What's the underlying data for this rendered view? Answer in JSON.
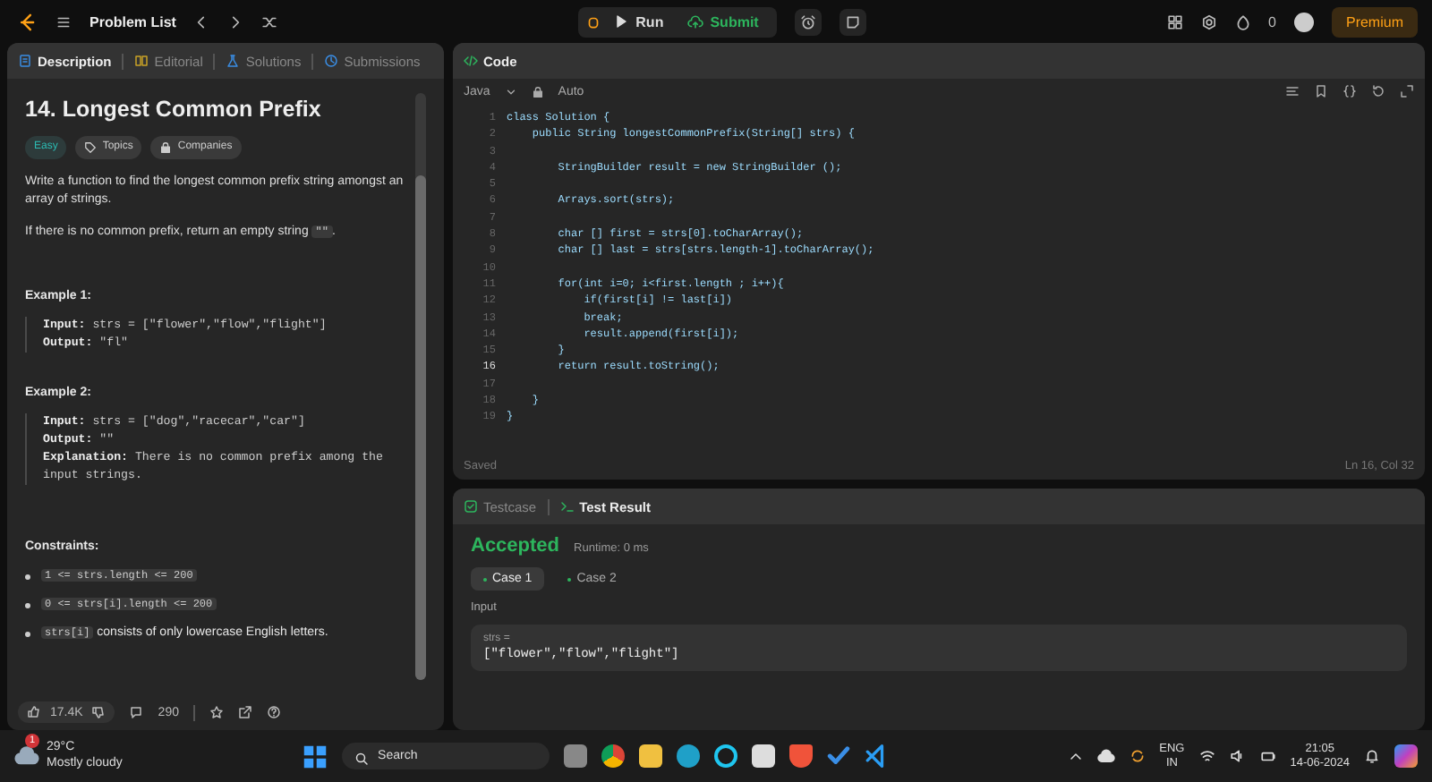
{
  "top_bar": {
    "nav_label": "Problem List",
    "run_label": "Run",
    "submit_label": "Submit",
    "streak_count": "0",
    "premium_label": "Premium"
  },
  "description_panel": {
    "tabs": [
      {
        "label": "Description",
        "selected": true
      },
      {
        "label": "Editorial",
        "selected": false
      },
      {
        "label": "Solutions",
        "selected": false
      },
      {
        "label": "Submissions",
        "selected": false
      }
    ],
    "title": "14. Longest Common Prefix",
    "difficulty": "Easy",
    "tags": [
      "Topics",
      "Companies"
    ],
    "paragraphs": [
      [
        {
          "kind": "text",
          "text": "Write a function to find the longest common prefix string amongst an array of strings."
        }
      ],
      [
        {
          "kind": "text",
          "text": "If there is no common prefix, return an empty string "
        },
        {
          "kind": "code",
          "text": "\"\""
        },
        {
          "kind": "text",
          "text": "."
        }
      ]
    ],
    "examples": [
      {
        "heading": "Example 1:",
        "lines": [
          {
            "label": "Input:",
            "value": "strs = [\"flower\",\"flow\",\"flight\"]"
          },
          {
            "label": "Output:",
            "value": "\"fl\""
          }
        ]
      },
      {
        "heading": "Example 2:",
        "lines": [
          {
            "label": "Input:",
            "value": "strs = [\"dog\",\"racecar\",\"car\"]"
          },
          {
            "label": "Output:",
            "value": "\"\""
          },
          {
            "label": "Explanation:",
            "value": "There is no common prefix among the input strings."
          }
        ]
      }
    ],
    "constraints_heading": "Constraints:",
    "constraints": [
      [
        {
          "kind": "code",
          "text": "1 <= strs.length <= 200"
        }
      ],
      [
        {
          "kind": "code",
          "text": "0 <= strs[i].length <= 200"
        }
      ],
      [
        {
          "kind": "code",
          "text": "strs[i]"
        },
        {
          "kind": "text",
          "text": " consists of only lowercase English letters."
        }
      ]
    ],
    "footer": {
      "likes": "17.4K",
      "comments": "290"
    }
  },
  "code_panel": {
    "title": "Code",
    "language": "Java",
    "mode": "Auto",
    "lines": [
      {
        "number": "1",
        "text": "class Solution {",
        "selected": false
      },
      {
        "number": "2",
        "text": "    public String longestCommonPrefix(String[] strs) {",
        "selected": false
      },
      {
        "number": "3",
        "selected": false
      },
      {
        "number": "4",
        "text": "        StringBuilder result = new StringBuilder ();",
        "selected": false
      },
      {
        "number": "5",
        "selected": false
      },
      {
        "number": "6",
        "text": "        Arrays.sort(strs);",
        "selected": false
      },
      {
        "number": "7",
        "selected": false
      },
      {
        "number": "8",
        "text": "        char [] first = strs[0].toCharArray();",
        "selected": false
      },
      {
        "number": "9",
        "text": "        char [] last = strs[strs.length-1].toCharArray();",
        "selected": false
      },
      {
        "number": "10",
        "selected": false
      },
      {
        "number": "11",
        "text": "        for(int i=0; i<first.length ; i++){",
        "selected": false
      },
      {
        "number": "12",
        "text": "            if(first[i] != last[i])",
        "selected": false
      },
      {
        "number": "13",
        "text": "            break;",
        "selected": false
      },
      {
        "number": "14",
        "text": "            result.append(first[i]);",
        "selected": false
      },
      {
        "number": "15",
        "text": "        }",
        "selected": false
      },
      {
        "number": "16",
        "text": "        return result.toString();",
        "selected": true
      },
      {
        "number": "17",
        "selected": false
      },
      {
        "number": "18",
        "text": "    }",
        "selected": false
      },
      {
        "number": "19",
        "text": "}",
        "selected": false
      }
    ],
    "status": "Saved",
    "cursor": "Ln 16, Col 32"
  },
  "test_panel": {
    "tabs": [
      {
        "label": "Testcase",
        "selected": false
      },
      {
        "label": "Test Result",
        "selected": true
      }
    ],
    "verdict": "Accepted",
    "runtime": "Runtime: 0 ms",
    "cases": [
      {
        "label": "Case 1",
        "selected": true
      },
      {
        "label": "Case 2",
        "selected": false
      }
    ],
    "input_label": "Input",
    "variable": "strs =",
    "value": "[\"flower\",\"flow\",\"flight\"]"
  },
  "taskbar": {
    "temperature": "29°C",
    "weather": "Mostly cloudy",
    "weather_badge": "1",
    "search_placeholder": "Search",
    "language": "ENG",
    "region": "IN",
    "time": "21:05",
    "date": "14-06-2024"
  }
}
